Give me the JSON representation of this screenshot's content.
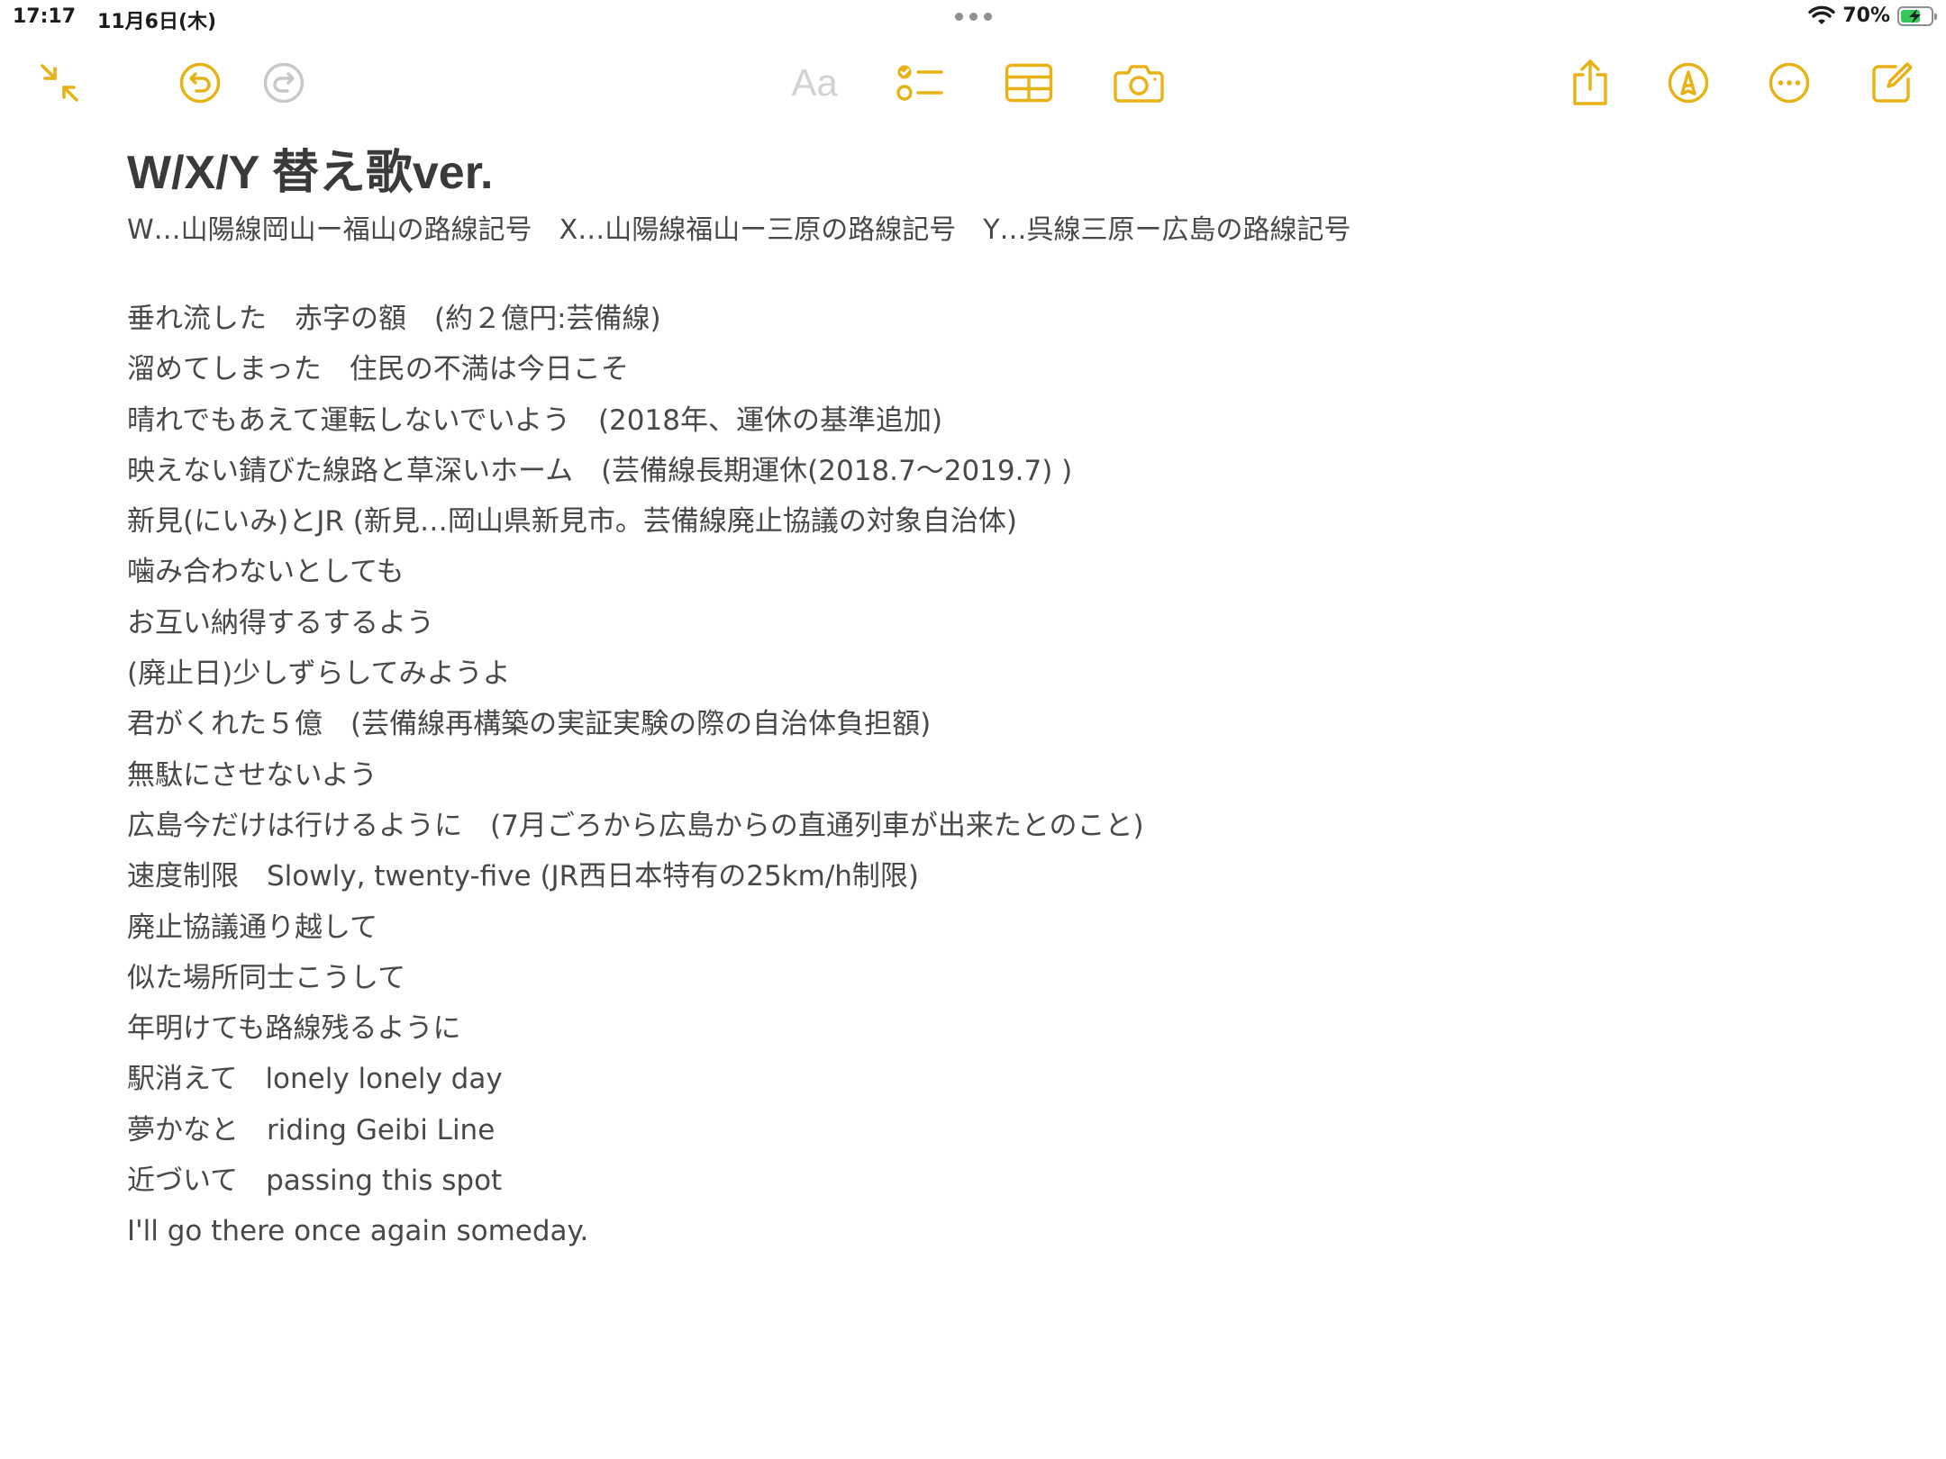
{
  "status_bar": {
    "time": "17:17",
    "date": "11月6日(木)",
    "battery_percent": "70%",
    "battery_level": 0.7,
    "charging": true
  },
  "toolbar": {
    "left": [
      "collapse-icon",
      "undo-icon",
      "redo-icon"
    ],
    "format_label": "Aa",
    "center": [
      "checklist-icon",
      "table-icon",
      "camera-icon"
    ],
    "right": [
      "share-icon",
      "markup-icon",
      "more-icon",
      "compose-icon"
    ],
    "accent_color": "#e8b215",
    "disabled_color": "#d1d1d6"
  },
  "note": {
    "title": "W/X/Y 替え歌ver.",
    "subtitle": "W…山陽線岡山ー福山の路線記号　X…山陽線福山ー三原の路線記号　Y…呉線三原ー広島の路線記号",
    "lines": [
      "垂れ流した　赤字の額　(約２億円:芸備線)",
      "溜めてしまった　住民の不満は今日こそ",
      "晴れでもあえて運転しないでいよう　(2018年、運休の基準追加)",
      "映えない錆びた線路と草深いホーム　(芸備線長期運休(2018.7～2019.7) )",
      "新見(にいみ)とJR  (新見…岡山県新見市。芸備線廃止協議の対象自治体)",
      "噛み合わないとしても",
      "お互い納得するするよう",
      "(廃止日)少しずらしてみようよ",
      "君がくれた５億　(芸備線再構築の実証実験の際の自治体負担額)",
      "無駄にさせないよう",
      "広島今だけは行けるように　(7月ごろから広島からの直通列車が出来たとのこと)",
      "速度制限　Slowly, twenty-five (JR西日本特有の25km/h制限)",
      "廃止協議通り越して",
      "似た場所同士こうして",
      "年明けても路線残るように",
      "駅消えて　lonely lonely day",
      "夢かなと　riding Geibi Line",
      "近づいて　passing this spot",
      "I'll go there once again someday."
    ]
  }
}
